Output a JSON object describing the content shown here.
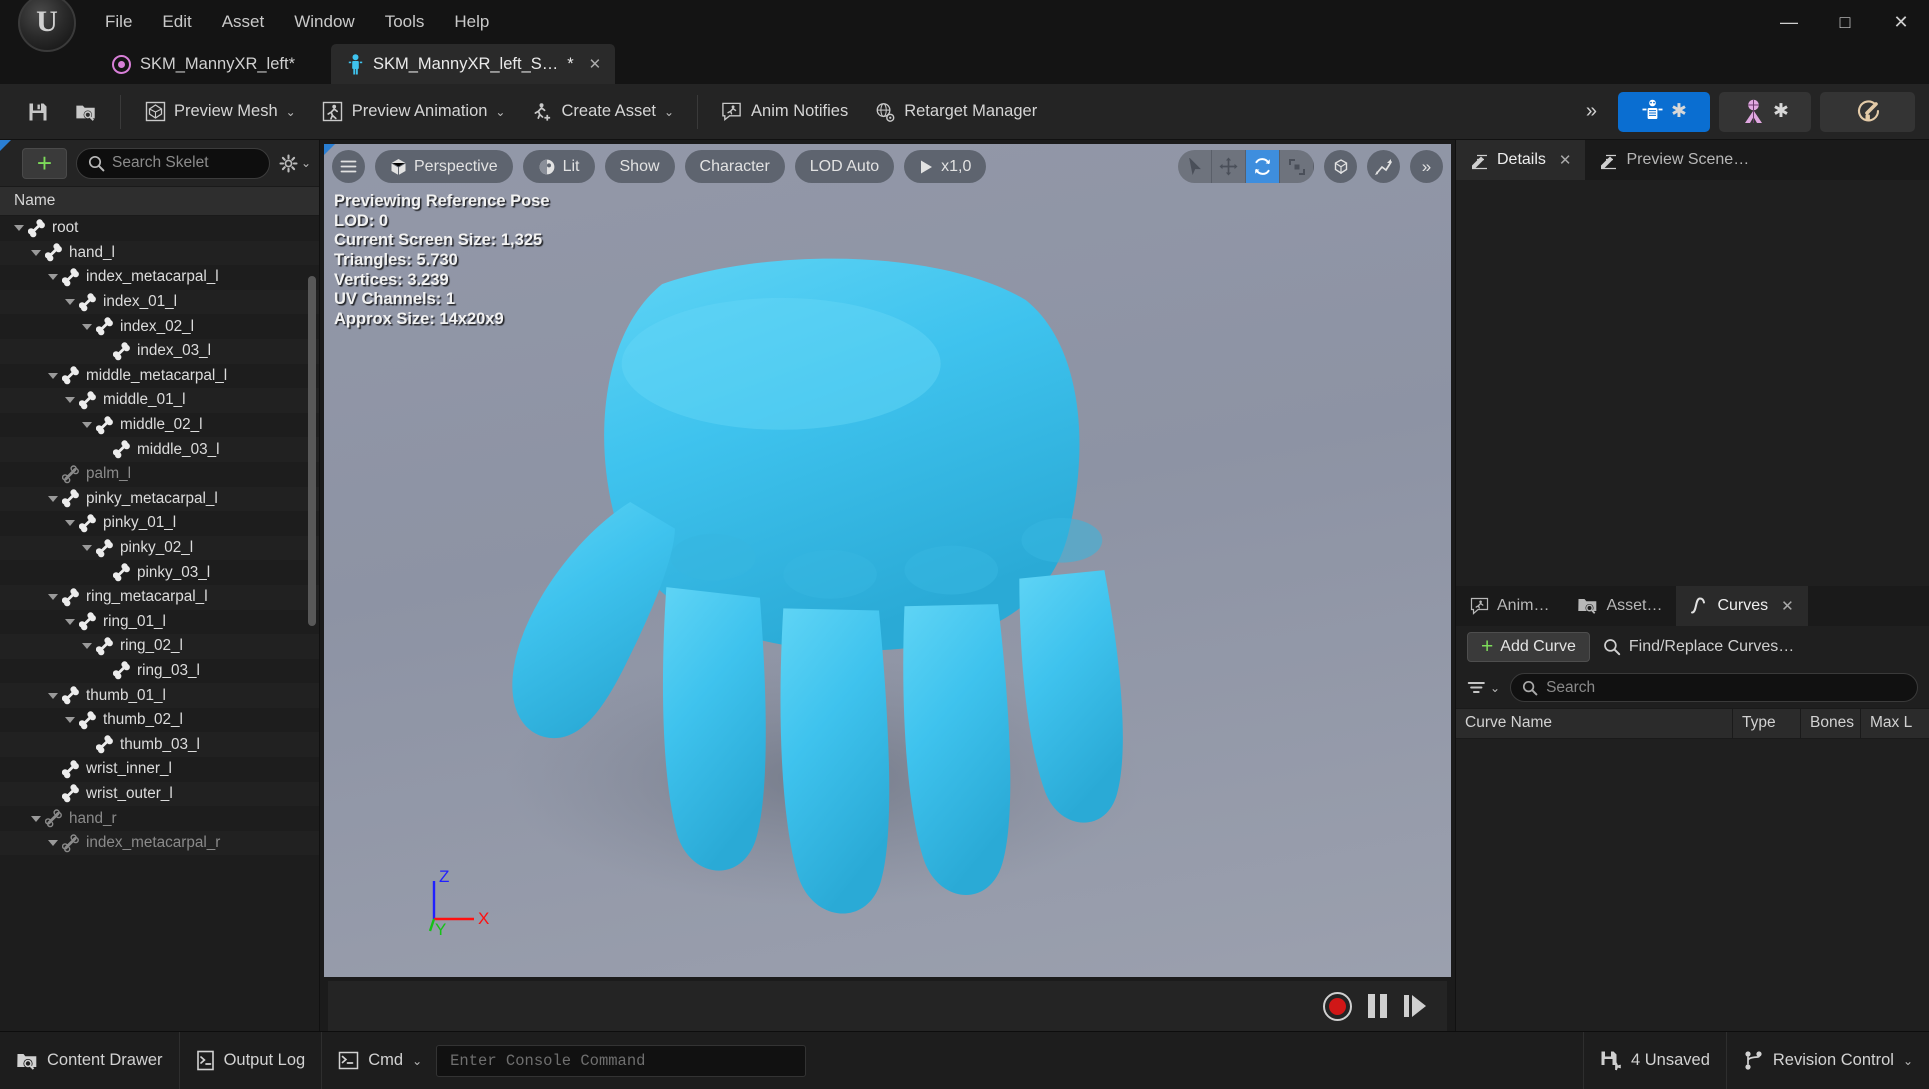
{
  "window": {
    "menus": [
      "File",
      "Edit",
      "Asset",
      "Window",
      "Tools",
      "Help"
    ],
    "minimize_label": "—",
    "maximize_label": "□",
    "close_label": "✕"
  },
  "tabs": {
    "asset_tab_label": "SKM_MannyXR_left*",
    "active_tab_label": "SKM_MannyXR_left_S…",
    "active_tab_dirty": "*",
    "active_tab_close": "✕"
  },
  "toolbar": {
    "save_icon": "save-icon",
    "browse_icon": "browse-content-icon",
    "items": [
      {
        "label": "Preview Mesh",
        "icon": "preview-mesh-icon",
        "chevron": "⌄"
      },
      {
        "label": "Preview Animation",
        "icon": "preview-animation-icon",
        "chevron": "⌄"
      },
      {
        "label": "Create Asset",
        "icon": "create-asset-icon",
        "chevron": "⌄"
      },
      {
        "label": "Anim Notifies",
        "icon": "anim-notifies-icon",
        "chevron": ""
      },
      {
        "label": "Retarget Manager",
        "icon": "retarget-manager-icon",
        "chevron": ""
      }
    ],
    "overflow_label": "»",
    "modes": [
      {
        "name": "skeleton-mode",
        "icon": "skeleton-icon",
        "star": "✱",
        "active": true
      },
      {
        "name": "mesh-mode",
        "icon": "mesh-person-icon",
        "star": "✱",
        "active": false
      },
      {
        "name": "physics-mode",
        "icon": "physics-icon",
        "star": "",
        "active": false
      }
    ]
  },
  "skeleton_panel": {
    "add_button_label": "+",
    "search_placeholder": "Search Skelet",
    "settings_icon": "gear-icon",
    "settings_chevron": "⌄",
    "column_header": "Name",
    "bones": [
      {
        "label": "root",
        "depth": 0,
        "expanded": true,
        "dim": false
      },
      {
        "label": "hand_l",
        "depth": 1,
        "expanded": true,
        "dim": false
      },
      {
        "label": "index_metacarpal_l",
        "depth": 2,
        "expanded": true,
        "dim": false
      },
      {
        "label": "index_01_l",
        "depth": 3,
        "expanded": true,
        "dim": false
      },
      {
        "label": "index_02_l",
        "depth": 4,
        "expanded": true,
        "dim": false
      },
      {
        "label": "index_03_l",
        "depth": 5,
        "expanded": false,
        "dim": false
      },
      {
        "label": "middle_metacarpal_l",
        "depth": 2,
        "expanded": true,
        "dim": false
      },
      {
        "label": "middle_01_l",
        "depth": 3,
        "expanded": true,
        "dim": false
      },
      {
        "label": "middle_02_l",
        "depth": 4,
        "expanded": true,
        "dim": false
      },
      {
        "label": "middle_03_l",
        "depth": 5,
        "expanded": false,
        "dim": false
      },
      {
        "label": "palm_l",
        "depth": 2,
        "expanded": false,
        "dim": true
      },
      {
        "label": "pinky_metacarpal_l",
        "depth": 2,
        "expanded": true,
        "dim": false
      },
      {
        "label": "pinky_01_l",
        "depth": 3,
        "expanded": true,
        "dim": false
      },
      {
        "label": "pinky_02_l",
        "depth": 4,
        "expanded": true,
        "dim": false
      },
      {
        "label": "pinky_03_l",
        "depth": 5,
        "expanded": false,
        "dim": false
      },
      {
        "label": "ring_metacarpal_l",
        "depth": 2,
        "expanded": true,
        "dim": false
      },
      {
        "label": "ring_01_l",
        "depth": 3,
        "expanded": true,
        "dim": false
      },
      {
        "label": "ring_02_l",
        "depth": 4,
        "expanded": true,
        "dim": false
      },
      {
        "label": "ring_03_l",
        "depth": 5,
        "expanded": false,
        "dim": false
      },
      {
        "label": "thumb_01_l",
        "depth": 2,
        "expanded": true,
        "dim": false
      },
      {
        "label": "thumb_02_l",
        "depth": 3,
        "expanded": true,
        "dim": false
      },
      {
        "label": "thumb_03_l",
        "depth": 4,
        "expanded": false,
        "dim": false
      },
      {
        "label": "wrist_inner_l",
        "depth": 2,
        "expanded": false,
        "dim": false
      },
      {
        "label": "wrist_outer_l",
        "depth": 2,
        "expanded": false,
        "dim": false
      },
      {
        "label": "hand_r",
        "depth": 1,
        "expanded": true,
        "dim": true
      },
      {
        "label": "index_metacarpal_r",
        "depth": 2,
        "expanded": true,
        "dim": true
      }
    ]
  },
  "viewport": {
    "menu_icon": "hamburger-icon",
    "buttons": [
      {
        "label": "Perspective",
        "icon": "cube-icon"
      },
      {
        "label": "Lit",
        "icon": "lighting-icon"
      },
      {
        "label": "Show",
        "icon": ""
      },
      {
        "label": "Character",
        "icon": ""
      },
      {
        "label": "LOD Auto",
        "icon": ""
      },
      {
        "label": "x1,0",
        "icon": "play-icon"
      }
    ],
    "gizmos": [
      {
        "name": "select-tool",
        "icon": "cursor-arrow-icon",
        "active": false
      },
      {
        "name": "translate-tool",
        "icon": "move-icon",
        "active": false
      },
      {
        "name": "rotate-tool",
        "icon": "rotate-icon",
        "active": true
      },
      {
        "name": "scale-tool",
        "icon": "scale-icon",
        "active": false
      }
    ],
    "extra_buttons": [
      {
        "name": "world-coords-button",
        "icon": "world-cube-icon"
      },
      {
        "name": "snap-button",
        "icon": "snapping-icon"
      },
      {
        "name": "viewport-overflow-button",
        "icon": "double-chevron-icon"
      }
    ],
    "stats": [
      "Previewing Reference Pose",
      "LOD: 0",
      "Current Screen Size: 1,325",
      "Triangles: 5.730",
      "Vertices: 3.239",
      "UV Channels: 1",
      "Approx Size: 14x20x9"
    ],
    "axis_labels": {
      "x": "X",
      "y": "Y",
      "z": "Z",
      "x_color": "#ff1010",
      "y_color": "#16c216",
      "z_color": "#2020ff"
    },
    "transport": {
      "record": "record-button",
      "pause": "pause-button",
      "step": "step-forward-button"
    }
  },
  "right_panel": {
    "top_tabs": [
      {
        "label": "Details",
        "icon": "details-icon",
        "active": true,
        "close": "✕"
      },
      {
        "label": "Preview Scene…",
        "icon": "details-icon",
        "active": false,
        "close": ""
      }
    ],
    "bottom_tabs": [
      {
        "label": "Anim…",
        "icon": "anim-notifies-icon",
        "active": false,
        "close": ""
      },
      {
        "label": "Asset…",
        "icon": "browse-content-icon",
        "active": false,
        "close": ""
      },
      {
        "label": "Curves",
        "icon": "curve-icon",
        "active": true,
        "close": "✕"
      }
    ],
    "curves": {
      "add_curve_label": "Add Curve",
      "add_curve_plus": "+",
      "find_replace_label": "Find/Replace Curves…",
      "filter_icon": "filter-icon",
      "filter_chevron": "⌄",
      "search_placeholder": "Search",
      "columns": [
        "Curve Name",
        "Type",
        "Bones",
        "Max L"
      ],
      "rows": []
    }
  },
  "statusbar": {
    "left_items": [
      {
        "label": "Content Drawer",
        "icon": "content-drawer-icon"
      },
      {
        "label": "Output Log",
        "icon": "output-log-icon"
      },
      {
        "label": "Cmd",
        "icon": "cmd-icon",
        "chevron": "⌄"
      }
    ],
    "console_placeholder": "Enter Console Command",
    "right_items": [
      {
        "label": "4 Unsaved",
        "icon": "unsaved-icon",
        "chevron": ""
      },
      {
        "label": "Revision Control",
        "icon": "revision-control-icon",
        "chevron": "⌄"
      }
    ]
  },
  "colors": {
    "accent_blue": "#0a6ed1",
    "mesh_cyan": "#3fc3ee",
    "green_plus": "#7ddc5a",
    "record_red": "#d01717",
    "pink": "#d87fd8"
  }
}
